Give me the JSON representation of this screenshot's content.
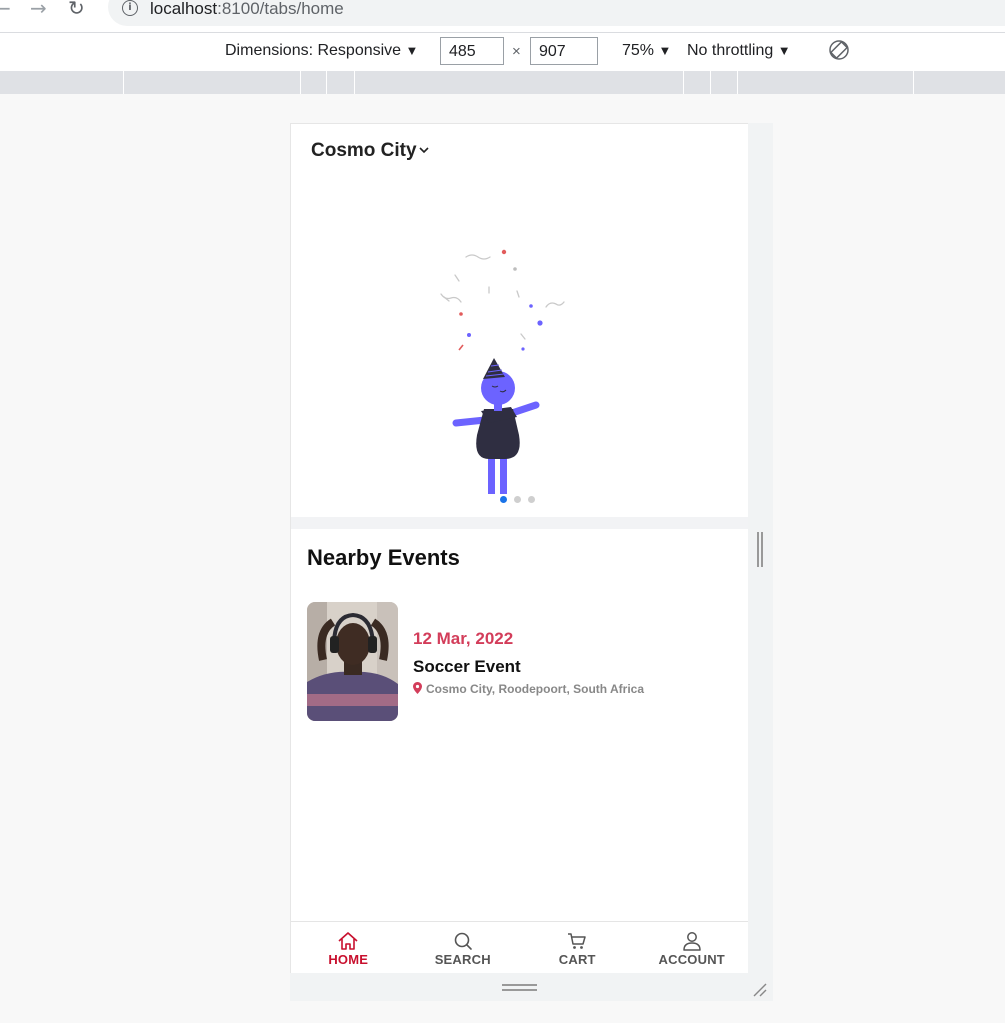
{
  "browser": {
    "url_host": "localhost",
    "url_path": ":8100/tabs/home"
  },
  "devtools": {
    "dimensions_label": "Dimensions: Responsive",
    "width": "485",
    "times": "×",
    "height": "907",
    "zoom": "75%",
    "throttling": "No throttling",
    "dropdown_arrow": "▼"
  },
  "app": {
    "location": "Cosmo City",
    "slider": {
      "slide_count": 3,
      "active_index": 0
    },
    "nearby_title": "Nearby Events",
    "events": [
      {
        "date": "12 Mar, 2022",
        "name": "Soccer Event",
        "location": "Cosmo City, Roodepoort, South Africa"
      }
    ],
    "tabs": [
      {
        "label": "HOME",
        "icon": "home-icon",
        "active": true
      },
      {
        "label": "SEARCH",
        "icon": "search-icon",
        "active": false
      },
      {
        "label": "CART",
        "icon": "cart-icon",
        "active": false
      },
      {
        "label": "ACCOUNT",
        "icon": "person-icon",
        "active": false
      }
    ]
  },
  "colors": {
    "accent": "#c8102e",
    "date": "#d33d5a",
    "illustration": "#6c63ff",
    "dot_active": "#1a73e8"
  }
}
